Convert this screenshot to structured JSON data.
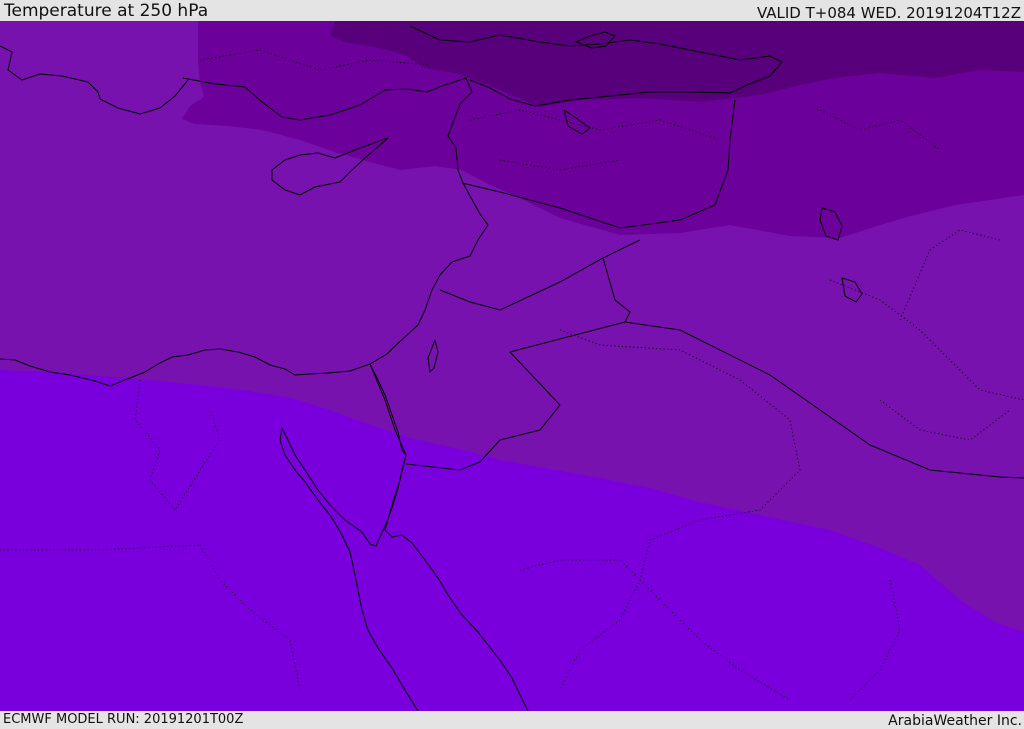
{
  "header": {
    "title": "Temperature at 250 hPa",
    "valid_time": "VALID T+084 WED. 20191204T12Z"
  },
  "footer": {
    "model_run": "ECMWF MODEL RUN: 20191201T00Z",
    "credit": "ArabiaWeather Inc."
  },
  "map": {
    "field": "Temperature at 250 hPa",
    "shading_levels": [
      {
        "name": "coldest",
        "color": "#58007c"
      },
      {
        "name": "colder",
        "color": "#6c009a"
      },
      {
        "name": "mid",
        "color": "#7812ae"
      },
      {
        "name": "warm",
        "color": "#7900dd"
      }
    ],
    "coastline_color": "#000000"
  }
}
